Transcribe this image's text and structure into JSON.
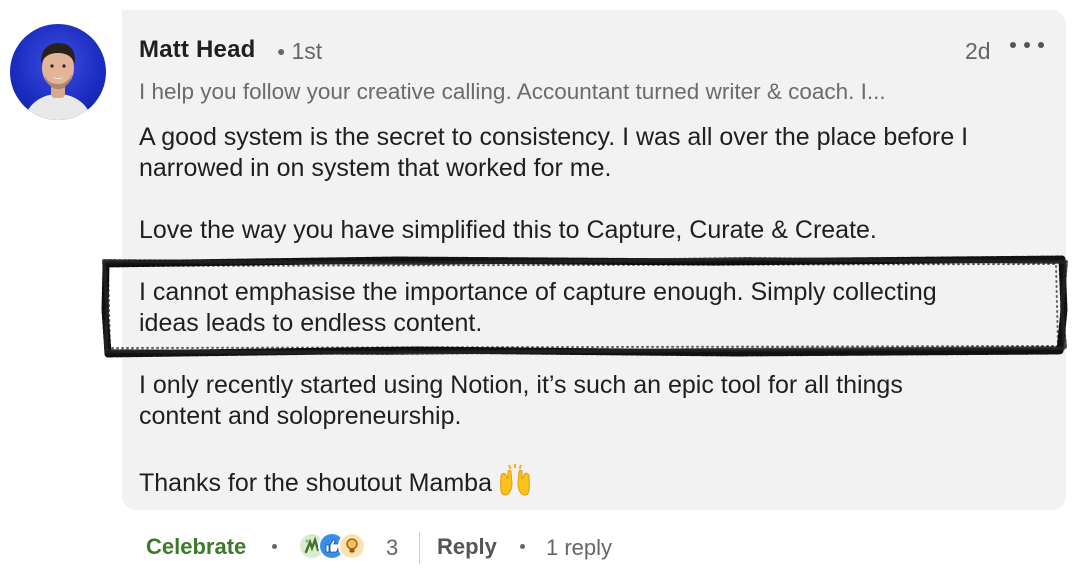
{
  "comment": {
    "author": "Matt Head",
    "degree": "1st",
    "time": "2d",
    "headline": "I help you follow your creative calling. Accountant turned writer & coach. I...",
    "paragraphs": [
      [
        "A good system is the secret to consistency. I was all over the place before I",
        "narrowed in on system that worked for me."
      ],
      [
        "Love the way you have simplified this to Capture, Curate & Create."
      ],
      [
        "I cannot emphasise the importance of capture enough. Simply collecting",
        "ideas leads to endless content."
      ],
      [
        "I only recently started using Notion, it’s such an epic tool for all things",
        "content and solopreneurship."
      ],
      [
        "Thanks for the shoutout Mamba"
      ]
    ],
    "closing_emoji": "raising-hands-emoji",
    "highlight_color": "#111111"
  },
  "footer": {
    "celebrate_label": "Celebrate",
    "reaction_icons": [
      "celebrate-reaction-icon",
      "like-reaction-icon",
      "insightful-reaction-icon"
    ],
    "reaction_count": "3",
    "reply_label": "Reply",
    "replies_label": "1 reply"
  },
  "colors": {
    "bubble_bg": "#f2f2f2",
    "celebrate_green": "#3e7a2b",
    "avatar_bg": "#1a2cc0"
  }
}
